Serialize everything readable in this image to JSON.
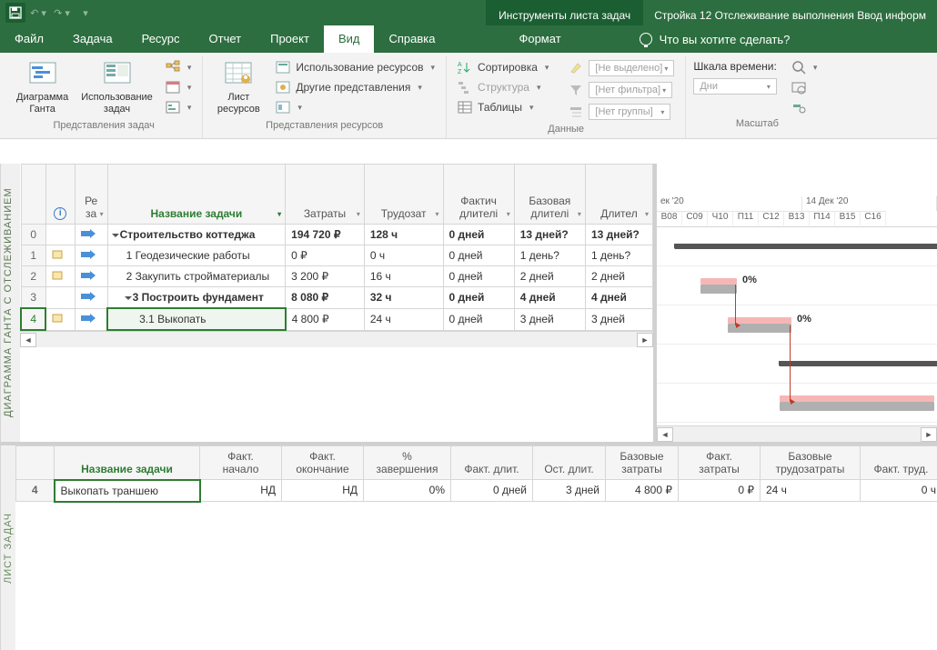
{
  "titlebar": {
    "context_tab": "Инструменты листа задач",
    "document_title": "Стройка 12 Отслеживание выполнения Ввод информ"
  },
  "tabs": {
    "file": "Файл",
    "task": "Задача",
    "resource": "Ресурс",
    "report": "Отчет",
    "project": "Проект",
    "view": "Вид",
    "help": "Справка",
    "format": "Формат",
    "tellme": "Что вы хотите сделать?"
  },
  "ribbon": {
    "group1_caption": "Представления задач",
    "gantt": "Диаграмма\nГанта",
    "task_usage": "Использование\nзадач",
    "group2_caption": "Представления ресурсов",
    "resource_sheet": "Лист\nресурсов",
    "res_usage": "Использование ресурсов",
    "other_views": "Другие представления",
    "group3_caption": "Данные",
    "sort": "Сортировка",
    "structure": "Структура",
    "tables": "Таблицы",
    "no_highlight": "[Не выделено]",
    "no_filter": "[Нет фильтра]",
    "no_group": "[Нет группы]",
    "group4_caption": "Масштаб",
    "timescale_label": "Шкала времени:",
    "timescale_value": "Дни"
  },
  "grid": {
    "side_title_top": "ДИАГРАММА ГАНТА С ОТСЛЕЖИВАНИЕМ",
    "side_title_bottom": "ЛИСТ ЗАДАЧ",
    "columns": {
      "info": "",
      "mode": "Ре\nза",
      "name": "Название задачи",
      "cost": "Затраты",
      "work": "Трудозат",
      "actual_dur": "Фактич\nдлителі",
      "base_dur": "Базовая\nдлителі",
      "dur": "Длител"
    },
    "rows": [
      {
        "num": "0",
        "name": "Строительство коттеджа",
        "cost": "194 720 ₽",
        "work": "128 ч",
        "adur": "0 дней",
        "bdur": "13 дней?",
        "dur": "13 дней?",
        "bold": true,
        "summary": true,
        "indent": 0
      },
      {
        "num": "1",
        "name": "1 Геодезические работы",
        "cost": "0 ₽",
        "work": "0 ч",
        "adur": "0 дней",
        "bdur": "1 день?",
        "dur": "1 день?",
        "bold": false,
        "indent": 1
      },
      {
        "num": "2",
        "name": "2 Закупить стройматериалы",
        "cost": "3 200 ₽",
        "work": "16 ч",
        "adur": "0 дней",
        "bdur": "2 дней",
        "dur": "2 дней",
        "bold": false,
        "indent": 1
      },
      {
        "num": "3",
        "name": "3 Построить фундамент",
        "cost": "8 080 ₽",
        "work": "32 ч",
        "adur": "0 дней",
        "bdur": "4 дней",
        "dur": "4 дней",
        "bold": true,
        "summary": true,
        "indent": 1
      },
      {
        "num": "4",
        "name": "3.1 Выкопать",
        "cost": "4 800 ₽",
        "work": "24 ч",
        "adur": "0 дней",
        "bdur": "3 дней",
        "dur": "3 дней",
        "bold": false,
        "indent": 2,
        "selected": true
      }
    ]
  },
  "gantt": {
    "week1": "ек '20",
    "week2": "14 Дек '20",
    "days": [
      "В08",
      "С09",
      "Ч10",
      "П11",
      "С12",
      "В13",
      "П14",
      "В15",
      "С16"
    ],
    "pct": "0%"
  },
  "bottom": {
    "columns": {
      "name": "Название задачи",
      "actual_start": "Факт.\nначало",
      "actual_finish": "Факт.\nокончание",
      "pct": "%\nзавершения",
      "actual_dur": "Факт. длит.",
      "rem_dur": "Ост. длит.",
      "base_cost": "Базовые\nзатраты",
      "actual_cost": "Факт.\nзатраты",
      "base_work": "Базовые\nтрудозатраты",
      "actual_work": "Факт. труд."
    },
    "row": {
      "num": "4",
      "name": "Выкопать траншею",
      "actual_start": "НД",
      "actual_finish": "НД",
      "pct": "0%",
      "actual_dur": "0 дней",
      "rem_dur": "3 дней",
      "base_cost": "4 800 ₽",
      "actual_cost": "0 ₽",
      "base_work": "24 ч",
      "actual_work": "0 ч"
    }
  }
}
